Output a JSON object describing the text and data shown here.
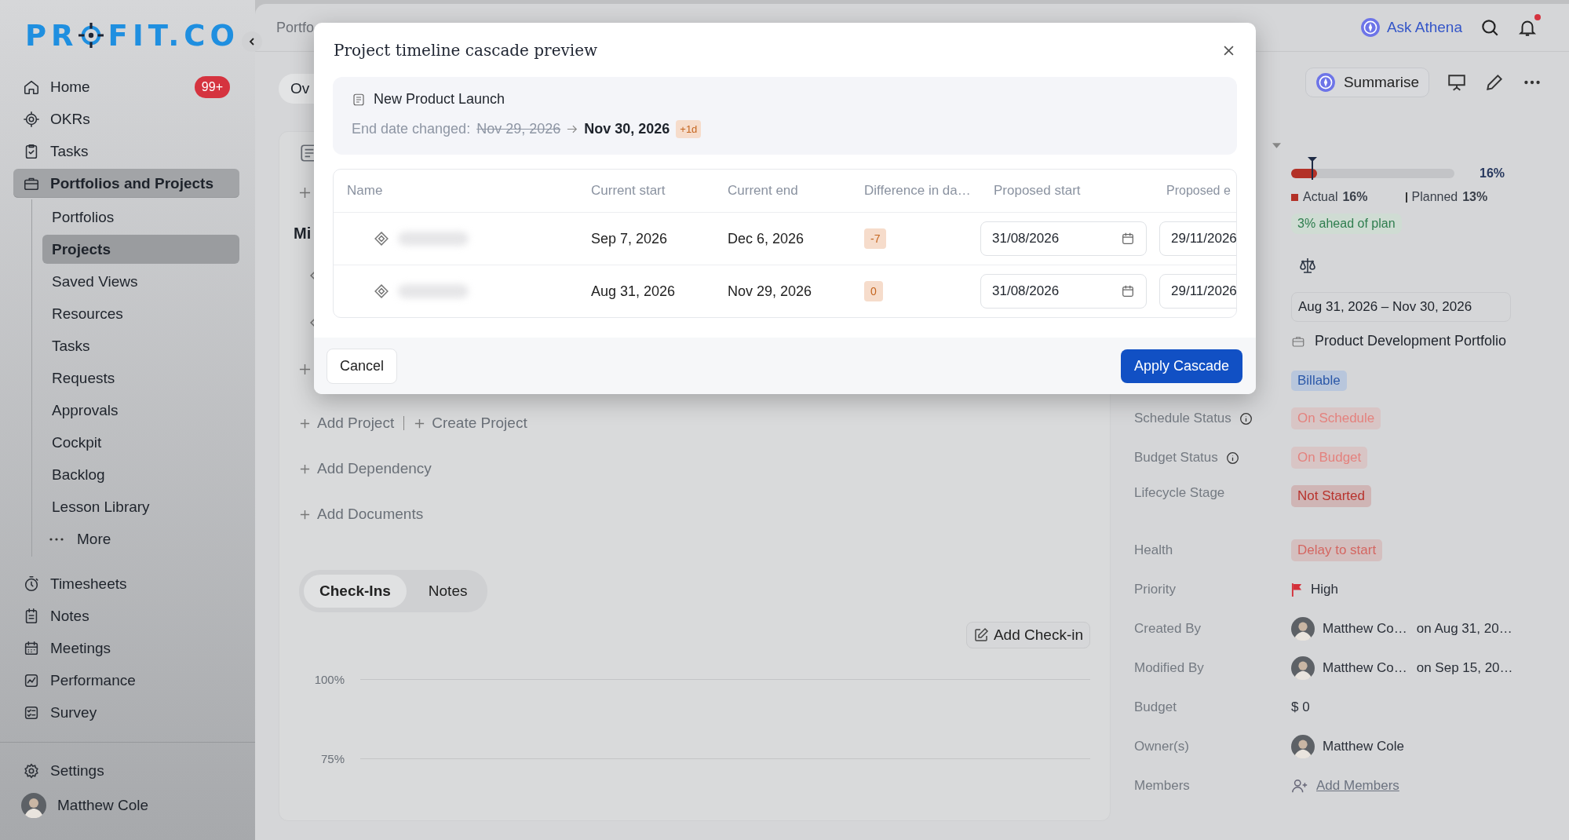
{
  "sidebar": {
    "logo": [
      "PR",
      "FIT.CO"
    ],
    "items": [
      {
        "label": "Home",
        "kind": "home",
        "badge": "99+",
        "selected": false
      },
      {
        "label": "OKRs",
        "kind": "target",
        "selected": false
      },
      {
        "label": "Tasks",
        "kind": "clipboard",
        "selected": false
      },
      {
        "label": "Portfolios and Projects",
        "kind": "briefcase",
        "selected": true,
        "expanded": true,
        "children": [
          {
            "label": "Portfolios",
            "selected": false
          },
          {
            "label": "Projects",
            "selected": true
          },
          {
            "label": "Saved Views",
            "selected": false
          },
          {
            "label": "Resources",
            "selected": false
          },
          {
            "label": "Tasks",
            "selected": false
          },
          {
            "label": "Requests",
            "selected": false
          },
          {
            "label": "Approvals",
            "selected": false
          },
          {
            "label": "Cockpit",
            "selected": false
          },
          {
            "label": "Backlog",
            "selected": false
          },
          {
            "label": "Lesson Library",
            "selected": false
          },
          {
            "label": "More",
            "kind": "more",
            "selected": false
          }
        ]
      },
      {
        "label": "Timesheets",
        "kind": "stopwatch",
        "selected": false
      },
      {
        "label": "Notes",
        "kind": "note",
        "selected": false
      },
      {
        "label": "Meetings",
        "kind": "calendar",
        "selected": false
      },
      {
        "label": "Performance",
        "kind": "chart",
        "selected": false
      },
      {
        "label": "Survey",
        "kind": "checklist",
        "selected": false
      }
    ],
    "settings": "Settings",
    "user": "Matthew Cole"
  },
  "header": {
    "breadcrumb": "Portfo",
    "assistant": "Ask Athena",
    "notification": true
  },
  "main": {
    "view_tab": "Ov",
    "section_heading": "Mi",
    "actions": [
      "Add Project",
      "Create Project"
    ],
    "links": [
      "Add Dependency",
      "Add Documents"
    ],
    "tabs": [
      {
        "label": "Check-Ins",
        "selected": true
      },
      {
        "label": "Notes",
        "selected": false
      }
    ],
    "add_checkin": "Add Check-in",
    "chart_labels": [
      "100%",
      "75%"
    ]
  },
  "details": {
    "summarise": "Summarise",
    "progress": {
      "actual": {
        "level": 0.16
      },
      "planned": {
        "level": 0.13
      },
      "reading": "16%",
      "actual_label": "Actual",
      "actual_value": "16%",
      "planned_label": "Planned",
      "planned_value": "13%",
      "note": "3% ahead of plan"
    },
    "date_range": "Aug 31, 2026 – Nov 30, 2026",
    "portfolio": "Product Development Portfolio",
    "billing": "Billable",
    "fields": [
      {
        "label": "Schedule Status",
        "info": true,
        "kind": "badge",
        "value": "On Schedule",
        "color": "#e4827e"
      },
      {
        "label": "Budget Status",
        "info": true,
        "kind": "badge",
        "value": "On Budget",
        "color": "#e4827e"
      },
      {
        "label": "Lifecycle Stage",
        "info": false,
        "kind": "badge",
        "value": "Not Started",
        "color": "#b8332d"
      },
      {
        "label": "Health",
        "info": false,
        "kind": "badge",
        "value": "Delay to start",
        "color": "#d46661"
      },
      {
        "label": "Priority",
        "info": false,
        "kind": "flag",
        "value": "High"
      },
      {
        "label": "Created By",
        "info": false,
        "kind": "person",
        "value": "Matthew Co…",
        "date": "on Aug 31, 20…"
      },
      {
        "label": "Modified By",
        "info": false,
        "kind": "person",
        "value": "Matthew Co…",
        "date": "on Sep 15, 20…"
      },
      {
        "label": "Budget",
        "info": false,
        "kind": "text",
        "value": "$ 0"
      },
      {
        "label": "Owner(s)",
        "info": false,
        "kind": "person",
        "value": "Matthew Cole"
      },
      {
        "label": "Members",
        "info": false,
        "kind": "link",
        "value": "Add Members"
      }
    ]
  },
  "modal": {
    "title": "Project timeline cascade preview",
    "project": "New Product Launch",
    "change_label": "End date changed:",
    "old_date": "Nov 29, 2026",
    "new_date": "Nov 30, 2026",
    "delta": "+1d",
    "columns": [
      "Name",
      "Current start",
      "Current end",
      "Difference in da…",
      "Proposed start",
      "Proposed e"
    ],
    "rows": [
      {
        "current_start": "Sep 7, 2026",
        "current_end": "Dec 6, 2026",
        "difference": "-7",
        "proposed_start": "31/08/2026",
        "proposed_end": "29/11/2026"
      },
      {
        "current_start": "Aug 31, 2026",
        "current_end": "Nov 29, 2026",
        "difference": "0",
        "proposed_start": "31/08/2026",
        "proposed_end": "29/11/2026"
      }
    ],
    "cancel": "Cancel",
    "apply": "Apply Cascade"
  }
}
